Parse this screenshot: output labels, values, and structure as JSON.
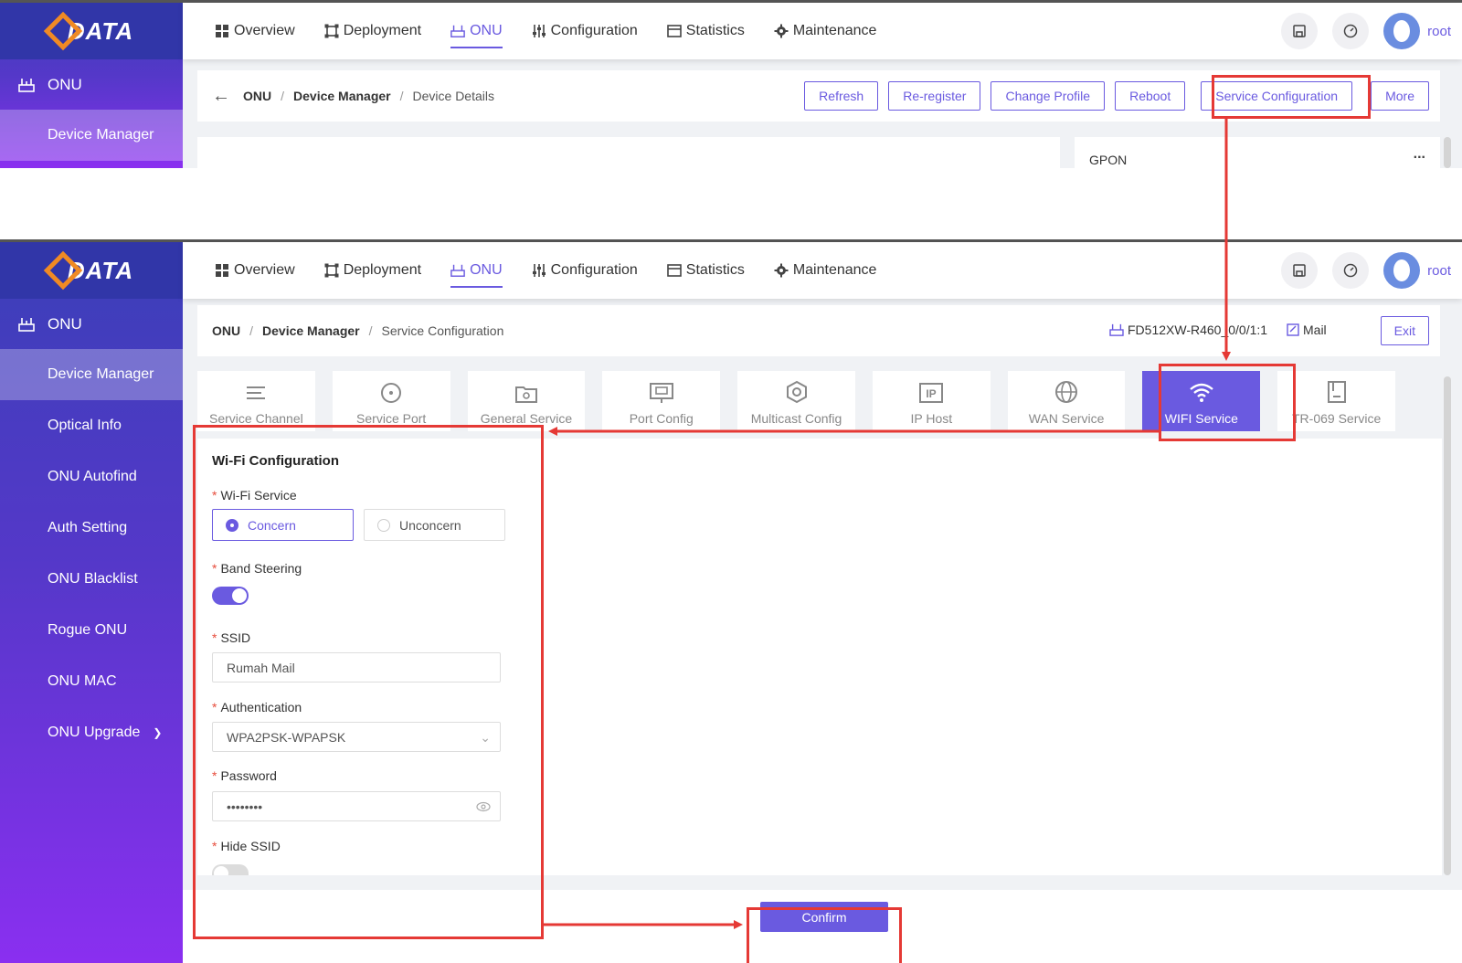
{
  "logo_text": "DATA",
  "accent_color": "#6a5ae0",
  "highlight_color": "#e53935",
  "nav": [
    {
      "label": "Overview",
      "icon": "grid-icon"
    },
    {
      "label": "Deployment",
      "icon": "deployment-icon"
    },
    {
      "label": "ONU",
      "icon": "onu-icon",
      "active": true
    },
    {
      "label": "Configuration",
      "icon": "sliders-icon"
    },
    {
      "label": "Statistics",
      "icon": "statistics-icon"
    },
    {
      "label": "Maintenance",
      "icon": "gear-icon"
    }
  ],
  "user": {
    "name": "root"
  },
  "screen1": {
    "sidebar": {
      "section": "ONU",
      "items": [
        "Device Manager"
      ]
    },
    "breadcrumb": {
      "root": "ONU",
      "middle": "Device Manager",
      "current": "Device Details"
    },
    "actions": [
      "Refresh",
      "Re-register",
      "Change Profile",
      "Reboot",
      "Service Configuration",
      "More"
    ],
    "side_panel_title": "GPON",
    "more_dots": "..."
  },
  "screen2": {
    "sidebar": {
      "section": "ONU",
      "items": [
        "Device Manager",
        "Optical Info",
        "ONU Autofind",
        "Auth Setting",
        "ONU Blacklist",
        "Rogue ONU",
        "ONU MAC",
        "ONU Upgrade"
      ]
    },
    "breadcrumb": {
      "root": "ONU",
      "middle": "Device Manager",
      "current": "Service Configuration"
    },
    "device_id": "FD512XW-R460_0/0/1:1",
    "mail_label": "Mail",
    "exit_label": "Exit",
    "tabs": [
      {
        "label": "Service Channel",
        "icon": "list-icon"
      },
      {
        "label": "Service Port",
        "icon": "target-icon"
      },
      {
        "label": "General Service",
        "icon": "folder-gear-icon"
      },
      {
        "label": "Port Config",
        "icon": "ethernet-port-icon"
      },
      {
        "label": "Multicast Config",
        "icon": "hexagon-nut-icon"
      },
      {
        "label": "IP Host",
        "icon": "ip-icon"
      },
      {
        "label": "WAN Service",
        "icon": "globe-icon"
      },
      {
        "label": "WIFI Service",
        "icon": "wifi-icon",
        "active": true
      },
      {
        "label": "TR-069 Service",
        "icon": "document-icon"
      }
    ],
    "form": {
      "title": "Wi-Fi Configuration",
      "wifi_service_label": "Wi-Fi  Service",
      "wifi_options": [
        "Concern",
        "Unconcern"
      ],
      "wifi_selected": "Concern",
      "band_steering_label": "Band Steering",
      "band_steering_on": true,
      "ssid_label": "SSID",
      "ssid_value": "Rumah Mail",
      "auth_label": "Authentication",
      "auth_value": "WPA2PSK-WPAPSK",
      "password_label": "Password",
      "password_value": "••••••••",
      "hide_ssid_label": "Hide SSID",
      "hide_ssid_on": false,
      "required_mark": "*"
    },
    "confirm_label": "Confirm"
  }
}
